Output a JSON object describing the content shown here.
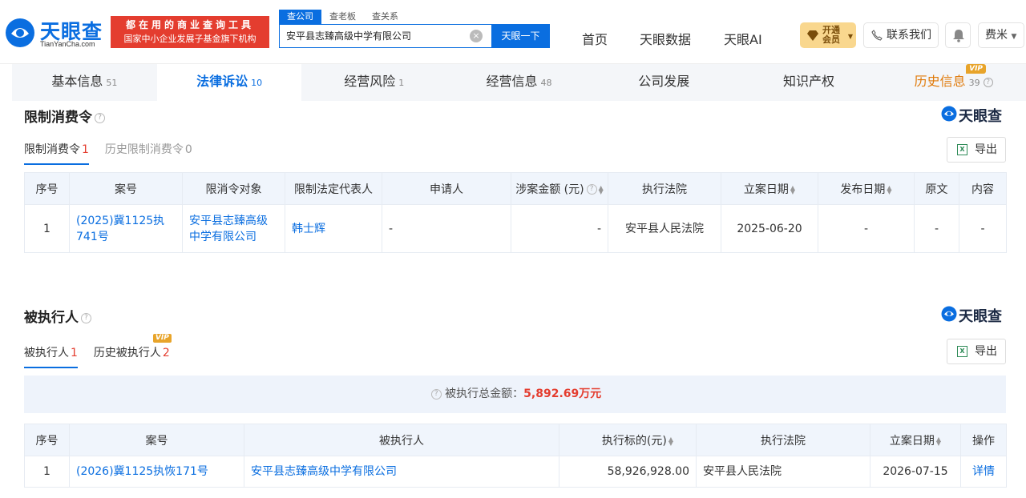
{
  "header": {
    "logo_cn": "天眼查",
    "logo_en": "TianYanCha.com",
    "slogan_line1": "都在用的商业查询工具",
    "slogan_line2": "国家中小企业发展子基金旗下机构",
    "search_tabs": [
      "查公司",
      "查老板",
      "查关系"
    ],
    "search_value": "安平县志臻高级中学有限公司",
    "search_button": "天眼一下",
    "nav": [
      "首页",
      "天眼数据",
      "天眼AI"
    ],
    "vip_label_1": "开通",
    "vip_label_2": "会员",
    "contact_label": "联系我们",
    "user_label": "费米"
  },
  "tabs": [
    {
      "label": "基本信息",
      "count": "51"
    },
    {
      "label": "法律诉讼",
      "count": "10"
    },
    {
      "label": "经营风险",
      "count": "1"
    },
    {
      "label": "经营信息",
      "count": "48"
    },
    {
      "label": "公司发展",
      "count": ""
    },
    {
      "label": "知识产权",
      "count": ""
    },
    {
      "label": "历史信息",
      "count": "39",
      "tag": "VIP"
    }
  ],
  "brand": "天眼查",
  "export_label": "导出",
  "restriction": {
    "title": "限制消费令",
    "subtabs": [
      {
        "label": "限制消费令",
        "count": "1"
      },
      {
        "label": "历史限制消费令",
        "count": "0"
      }
    ],
    "columns": [
      "序号",
      "案号",
      "限消令对象",
      "限制法定代表人",
      "申请人",
      "涉案金额 (元)",
      "执行法院",
      "立案日期",
      "发布日期",
      "原文",
      "内容"
    ],
    "rows": [
      {
        "idx": "1",
        "case_no": "(2025)冀1125执741号",
        "target": "安平县志臻高级中学有限公司",
        "legal_rep": "韩士辉",
        "applicant": "-",
        "amount": "-",
        "court": "安平县人民法院",
        "filed": "2025-06-20",
        "published": "-",
        "original": "-",
        "content": "-"
      }
    ]
  },
  "executed": {
    "title": "被执行人",
    "subtabs": [
      {
        "label": "被执行人",
        "count": "1"
      },
      {
        "label": "历史被执行人",
        "count": "2",
        "tag": "VIP"
      }
    ],
    "total_label": "被执行总金额：",
    "total_value": "5,892.69万元",
    "columns": [
      "序号",
      "案号",
      "被执行人",
      "执行标的(元)",
      "执行法院",
      "立案日期",
      "操作"
    ],
    "rows": [
      {
        "idx": "1",
        "case_no": "(2026)冀1125执恢171号",
        "name": "安平县志臻高级中学有限公司",
        "amount": "58,926,928.00",
        "court": "安平县人民法院",
        "filed": "2026-07-15",
        "action": "详情"
      }
    ]
  }
}
